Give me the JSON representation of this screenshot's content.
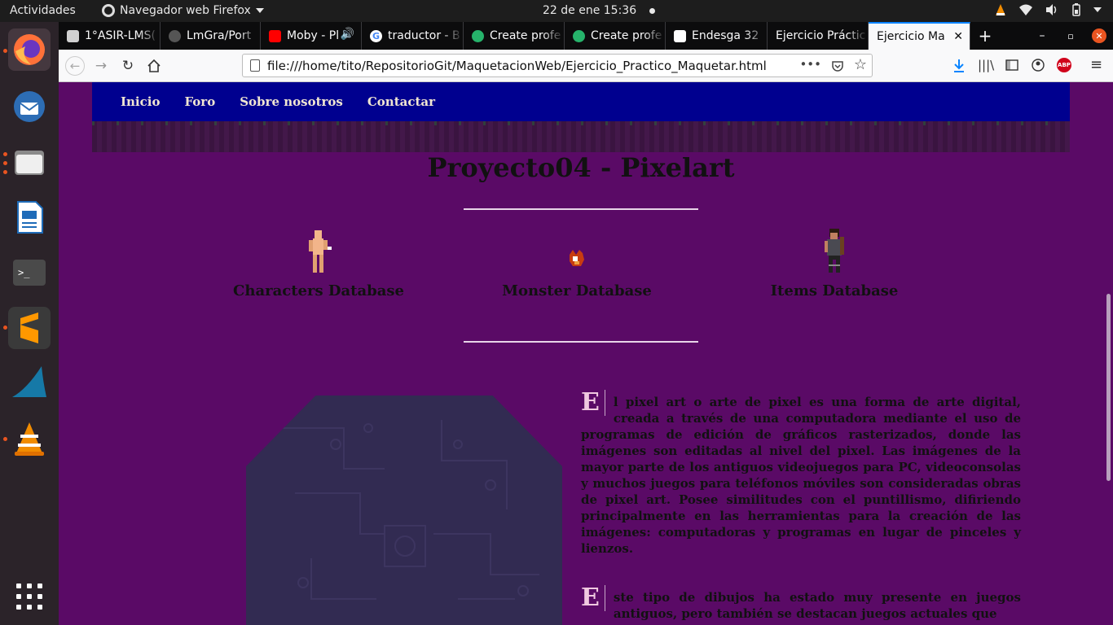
{
  "system_bar": {
    "activities": "Actividades",
    "app_menu": "Navegador web Firefox",
    "datetime": "22 de ene  15:36"
  },
  "dock": {
    "icons": [
      "firefox-icon",
      "thunderbird-icon",
      "files-icon",
      "writer-icon",
      "terminal-icon",
      "sublime-icon",
      "wireshark-icon",
      "vlc-icon",
      "show-apps-icon"
    ]
  },
  "tabs": [
    {
      "label": "1°ASIR-LMS(",
      "favicon_color": "#d0d0d0"
    },
    {
      "label": "LmGra/Port",
      "favicon_color": "#555555"
    },
    {
      "label": "Moby - Pl",
      "favicon_color": "#ff0000"
    },
    {
      "label": "traductor - B",
      "favicon_color": "#ffffff"
    },
    {
      "label": "Create profe",
      "favicon_color": "#26b36b"
    },
    {
      "label": "Create profe",
      "favicon_color": "#26b36b"
    },
    {
      "label": "Endesga 32",
      "favicon_color": "#ffffff"
    },
    {
      "label": "Ejercicio Práctic",
      "favicon_color": "#0c0c0d"
    },
    {
      "label": "Ejercicio Ma",
      "favicon_color": "#f9f9fa"
    }
  ],
  "urlbar": {
    "url": "file:///home/tito/RepositorioGit/MaquetacionWeb/Ejercicio_Practico_Maquetar.html"
  },
  "site": {
    "nav": [
      "Inicio",
      "Foro",
      "Sobre nosotros",
      "Contactar"
    ],
    "title": "Proyecto04 - Pixelart",
    "databases": [
      "Characters Database",
      "Monster Database",
      "Items Database"
    ],
    "paragraphs": [
      {
        "initial": "E",
        "text": "l pixel art o arte de pixel es una forma de arte digital, creada a través de una computadora mediante el uso de programas de edición de gráficos rasterizados, donde las imágenes son editadas al nivel del pixel. Las imágenes de la mayor parte de los antiguos videojuegos para PC, videoconsolas y muchos juegos para teléfonos móviles son consideradas obras de pixel art. Posee similitudes con el puntillismo, difiriendo principalmente en las herramientas para la creación de las imágenes: computadoras y programas en lugar de pinceles y lienzos."
      },
      {
        "initial": "E",
        "text": "ste tipo de dibujos ha estado muy presente en juegos antiguos, pero también se destacan juegos actuales que"
      }
    ]
  },
  "colors": {
    "page_bg": "#5a0a66",
    "site_nav_bg": "#00008f",
    "accent_blue": "#0a84ff"
  }
}
